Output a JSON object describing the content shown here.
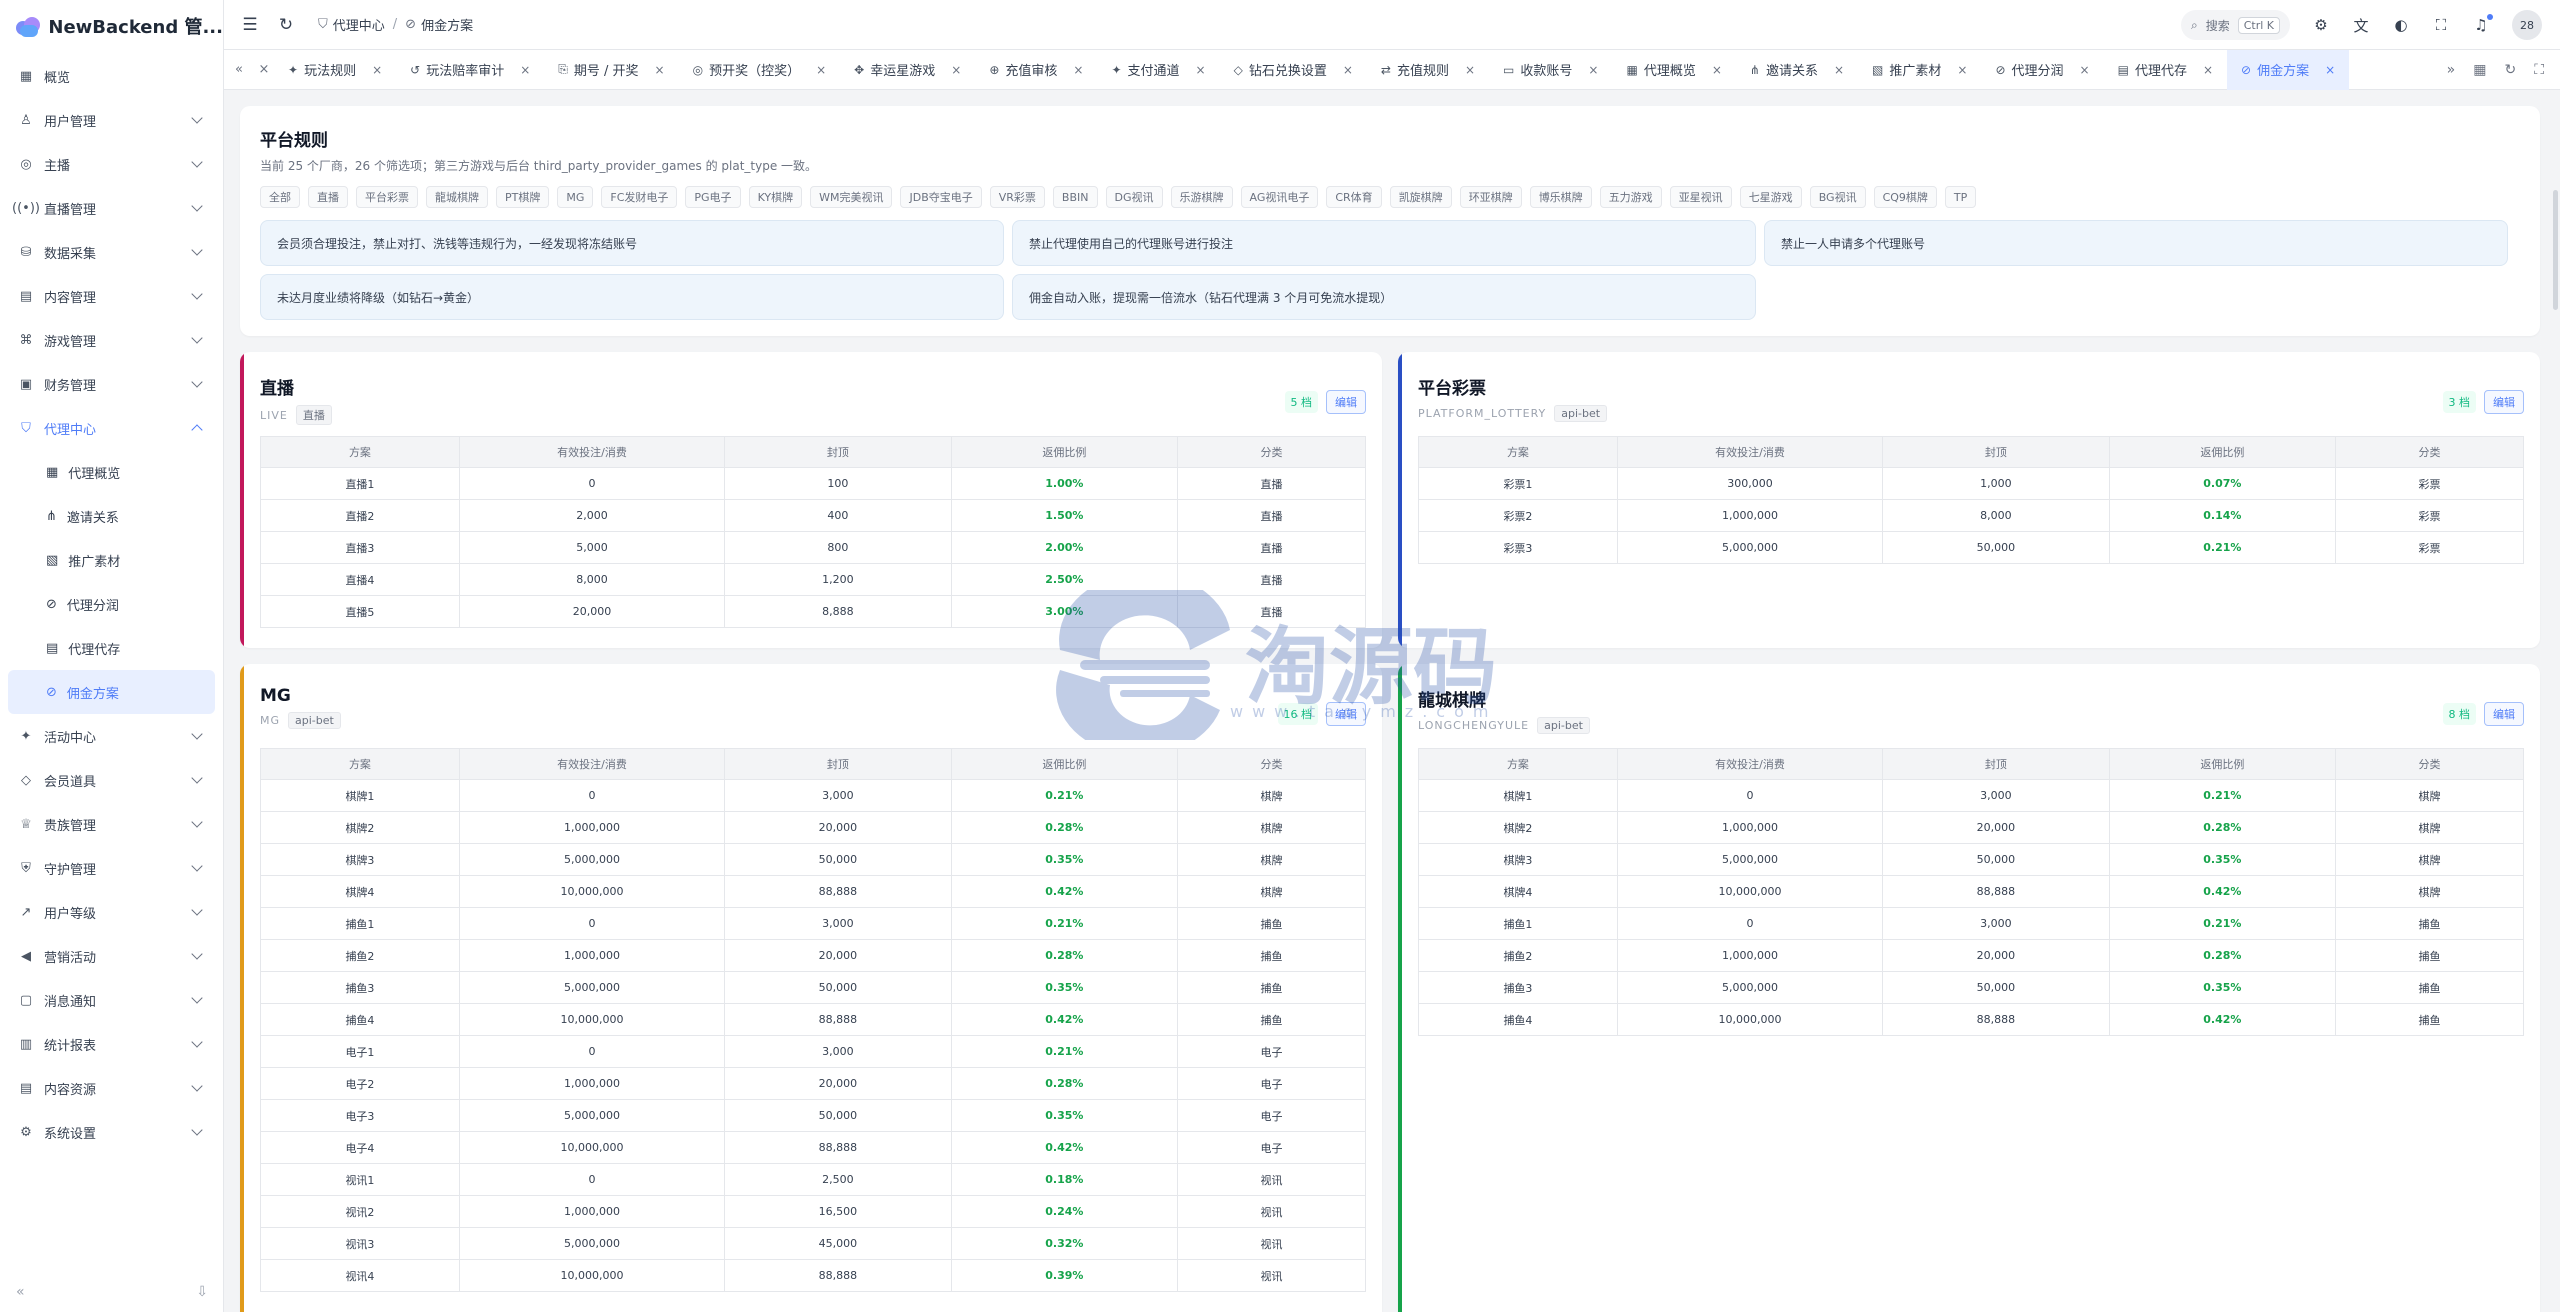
{
  "app": {
    "brand": "NewBackend 管..."
  },
  "sidebar": {
    "items": [
      {
        "label": "概览",
        "icon": "▦",
        "name": "overview"
      },
      {
        "label": "用户管理",
        "icon": "♙",
        "name": "users",
        "chev": true
      },
      {
        "label": "主播",
        "icon": "◎",
        "name": "anchor",
        "chev": true
      },
      {
        "label": "直播管理",
        "icon": "((•))",
        "name": "live",
        "chev": true
      },
      {
        "label": "数据采集",
        "icon": "⛁",
        "name": "data-collect",
        "chev": true
      },
      {
        "label": "内容管理",
        "icon": "▤",
        "name": "content",
        "chev": true
      },
      {
        "label": "游戏管理",
        "icon": "⌘",
        "name": "games",
        "chev": true
      },
      {
        "label": "财务管理",
        "icon": "▣",
        "name": "finance",
        "chev": true
      }
    ],
    "agent_center": {
      "label": "代理中心",
      "icon": "⛉"
    },
    "sub_items": [
      {
        "label": "代理概览",
        "icon": "▦"
      },
      {
        "label": "邀请关系",
        "icon": "⋔"
      },
      {
        "label": "推广素材",
        "icon": "▧"
      },
      {
        "label": "代理分润",
        "icon": "⊘"
      },
      {
        "label": "代理代存",
        "icon": "▤"
      },
      {
        "label": "佣金方案",
        "icon": "⊘"
      }
    ],
    "items_after": [
      {
        "label": "活动中心",
        "icon": "✦",
        "name": "activity"
      },
      {
        "label": "会员道具",
        "icon": "◇",
        "name": "props"
      },
      {
        "label": "贵族管理",
        "icon": "♕",
        "name": "nobility"
      },
      {
        "label": "守护管理",
        "icon": "⛨",
        "name": "guard"
      },
      {
        "label": "用户等级",
        "icon": "↗",
        "name": "user-level"
      },
      {
        "label": "营销活动",
        "icon": "◀",
        "name": "marketing"
      },
      {
        "label": "消息通知",
        "icon": "▢",
        "name": "messages"
      },
      {
        "label": "统计报表",
        "icon": "▥",
        "name": "reports"
      },
      {
        "label": "内容资源",
        "icon": "▤",
        "name": "resources"
      },
      {
        "label": "系统设置",
        "icon": "⚙",
        "name": "settings"
      }
    ]
  },
  "header": {
    "crumb1": "代理中心",
    "crumb2": "佣金方案",
    "search_label": "搜索",
    "search_kbd": "Ctrl K",
    "avatar": "28"
  },
  "tabs": [
    {
      "label": "玩法规则",
      "icon": "✦"
    },
    {
      "label": "玩法赔率审计",
      "icon": "↺"
    },
    {
      "label": "期号 / 开奖",
      "icon": "⎘"
    },
    {
      "label": "预开奖（控奖）",
      "icon": "◎"
    },
    {
      "label": "幸运星游戏",
      "icon": "✥"
    },
    {
      "label": "充值审核",
      "icon": "⊕"
    },
    {
      "label": "支付通道",
      "icon": "✦"
    },
    {
      "label": "钻石兑换设置",
      "icon": "◇"
    },
    {
      "label": "充值规则",
      "icon": "⇄"
    },
    {
      "label": "收款账号",
      "icon": "▭"
    },
    {
      "label": "代理概览",
      "icon": "▦"
    },
    {
      "label": "邀请关系",
      "icon": "⋔"
    },
    {
      "label": "推广素材",
      "icon": "▧"
    },
    {
      "label": "代理分润",
      "icon": "⊘"
    },
    {
      "label": "代理代存",
      "icon": "▤"
    },
    {
      "label": "佣金方案",
      "icon": "⊘",
      "active": true
    }
  ],
  "rules": {
    "title": "平台规则",
    "subtitle": "当前 25 个厂商，26 个筛选项；第三方游戏与后台 third_party_provider_games 的 plat_type 一致。",
    "chips": [
      "全部",
      "直播",
      "平台彩票",
      "龍城棋牌",
      "PT棋牌",
      "MG",
      "FC发财电子",
      "PG电子",
      "KY棋牌",
      "WM完美视讯",
      "JDB夺宝电子",
      "VR彩票",
      "BBIN",
      "DG视讯",
      "乐游棋牌",
      "AG视讯电子",
      "CR体育",
      "凯旋棋牌",
      "环亚棋牌",
      "博乐棋牌",
      "五力游戏",
      "亚星视讯",
      "七星游戏",
      "BG视讯",
      "CQ9棋牌",
      "TP"
    ],
    "boxes": [
      "会员须合理投注，禁止对打、洗钱等违规行为，一经发现将冻结账号",
      "禁止代理使用自己的代理账号进行投注",
      "禁止一人申请多个代理账号",
      "未达月度业绩将降级（如钻石→黄金）",
      "佣金自动入账，提现需一倍流水（钻石代理满 3 个月可免流水提现）"
    ]
  },
  "table_headers": [
    "方案",
    "有效投注/消费",
    "封顶",
    "返佣比例",
    "分类"
  ],
  "plans": {
    "live": {
      "title": "直播",
      "code": "LIVE",
      "tag": "直播",
      "count": "5 档",
      "edit": "编辑",
      "rows": [
        [
          "直播1",
          "0",
          "100",
          "1.00%",
          "直播"
        ],
        [
          "直播2",
          "2,000",
          "400",
          "1.50%",
          "直播"
        ],
        [
          "直播3",
          "5,000",
          "800",
          "2.00%",
          "直播"
        ],
        [
          "直播4",
          "8,000",
          "1,200",
          "2.50%",
          "直播"
        ],
        [
          "直播5",
          "20,000",
          "8,888",
          "3.00%",
          "直播"
        ]
      ]
    },
    "lottery": {
      "title": "平台彩票",
      "code": "PLATFORM_LOTTERY",
      "tag": "api-bet",
      "count": "3 档",
      "edit": "编辑",
      "rows": [
        [
          "彩票1",
          "300,000",
          "1,000",
          "0.07%",
          "彩票"
        ],
        [
          "彩票2",
          "1,000,000",
          "8,000",
          "0.14%",
          "彩票"
        ],
        [
          "彩票3",
          "5,000,000",
          "50,000",
          "0.21%",
          "彩票"
        ]
      ]
    },
    "mg": {
      "title": "MG",
      "code": "MG",
      "tag": "api-bet",
      "count": "16 档",
      "edit": "编辑",
      "rows": [
        [
          "棋牌1",
          "0",
          "3,000",
          "0.21%",
          "棋牌"
        ],
        [
          "棋牌2",
          "1,000,000",
          "20,000",
          "0.28%",
          "棋牌"
        ],
        [
          "棋牌3",
          "5,000,000",
          "50,000",
          "0.35%",
          "棋牌"
        ],
        [
          "棋牌4",
          "10,000,000",
          "88,888",
          "0.42%",
          "棋牌"
        ],
        [
          "捕鱼1",
          "0",
          "3,000",
          "0.21%",
          "捕鱼"
        ],
        [
          "捕鱼2",
          "1,000,000",
          "20,000",
          "0.28%",
          "捕鱼"
        ],
        [
          "捕鱼3",
          "5,000,000",
          "50,000",
          "0.35%",
          "捕鱼"
        ],
        [
          "捕鱼4",
          "10,000,000",
          "88,888",
          "0.42%",
          "捕鱼"
        ],
        [
          "电子1",
          "0",
          "3,000",
          "0.21%",
          "电子"
        ],
        [
          "电子2",
          "1,000,000",
          "20,000",
          "0.28%",
          "电子"
        ],
        [
          "电子3",
          "5,000,000",
          "50,000",
          "0.35%",
          "电子"
        ],
        [
          "电子4",
          "10,000,000",
          "88,888",
          "0.42%",
          "电子"
        ],
        [
          "视讯1",
          "0",
          "2,500",
          "0.18%",
          "视讯"
        ],
        [
          "视讯2",
          "1,000,000",
          "16,500",
          "0.24%",
          "视讯"
        ],
        [
          "视讯3",
          "5,000,000",
          "45,000",
          "0.32%",
          "视讯"
        ],
        [
          "视讯4",
          "10,000,000",
          "88,888",
          "0.39%",
          "视讯"
        ]
      ]
    },
    "longcheng": {
      "title": "龍城棋牌",
      "code": "LONGCHENGYULE",
      "tag": "api-bet",
      "count": "8 档",
      "edit": "编辑",
      "rows": [
        [
          "棋牌1",
          "0",
          "3,000",
          "0.21%",
          "棋牌"
        ],
        [
          "棋牌2",
          "1,000,000",
          "20,000",
          "0.28%",
          "棋牌"
        ],
        [
          "棋牌3",
          "5,000,000",
          "50,000",
          "0.35%",
          "棋牌"
        ],
        [
          "棋牌4",
          "10,000,000",
          "88,888",
          "0.42%",
          "棋牌"
        ],
        [
          "捕鱼1",
          "0",
          "3,000",
          "0.21%",
          "捕鱼"
        ],
        [
          "捕鱼2",
          "1,000,000",
          "20,000",
          "0.28%",
          "捕鱼"
        ],
        [
          "捕鱼3",
          "5,000,000",
          "50,000",
          "0.35%",
          "捕鱼"
        ],
        [
          "捕鱼4",
          "10,000,000",
          "88,888",
          "0.42%",
          "捕鱼"
        ]
      ]
    }
  },
  "watermark": {
    "text": "淘源码",
    "url": "www.taoymz.com"
  },
  "colors": {
    "accent": "#4f7cf7",
    "live_accent": "#c2185b",
    "lottery_accent": "#2a4fc4",
    "mg_accent": "#e09a1a",
    "longcheng_accent": "#16a34a",
    "ratio_green": "#16a34a"
  }
}
